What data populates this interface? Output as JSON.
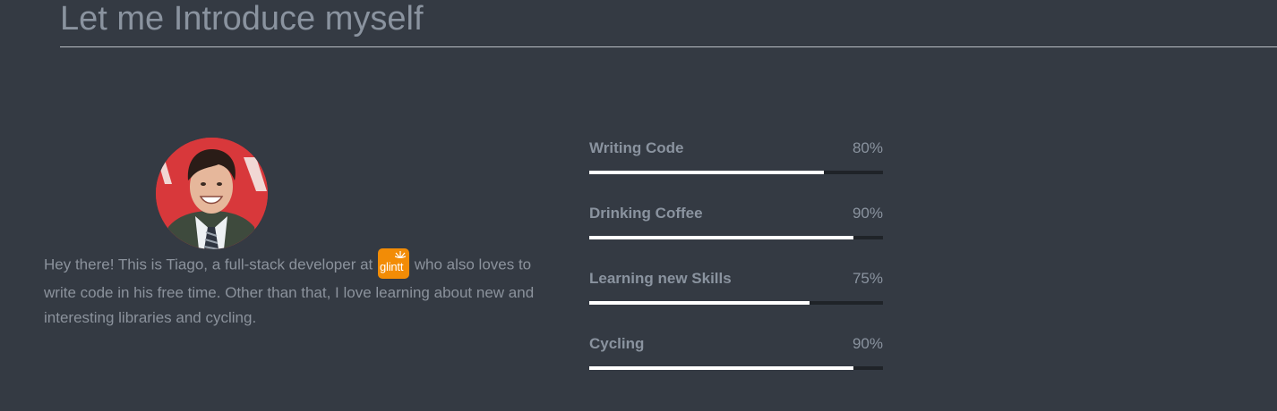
{
  "header": {
    "title": "Let me Introduce myself"
  },
  "about": {
    "intro_before": "Hey there! This is Tiago, a full-stack developer at",
    "company_logo_text": "glintt",
    "intro_after": "who also loves to write code in his free time. Other than that, I love learning about new and interesting libraries and cycling."
  },
  "skills": [
    {
      "name": "Writing Code",
      "percent_label": "80%",
      "level": 80
    },
    {
      "name": "Drinking Coffee",
      "percent_label": "90%",
      "level": 90
    },
    {
      "name": "Learning new Skills",
      "percent_label": "75%",
      "level": 75
    },
    {
      "name": "Cycling",
      "percent_label": "90%",
      "level": 90
    }
  ],
  "colors": {
    "background": "#343a43",
    "text": "#8b929c",
    "bar_track": "#1f2328",
    "bar_fill": "#ffffff",
    "logo_orange": "#f28c06"
  }
}
